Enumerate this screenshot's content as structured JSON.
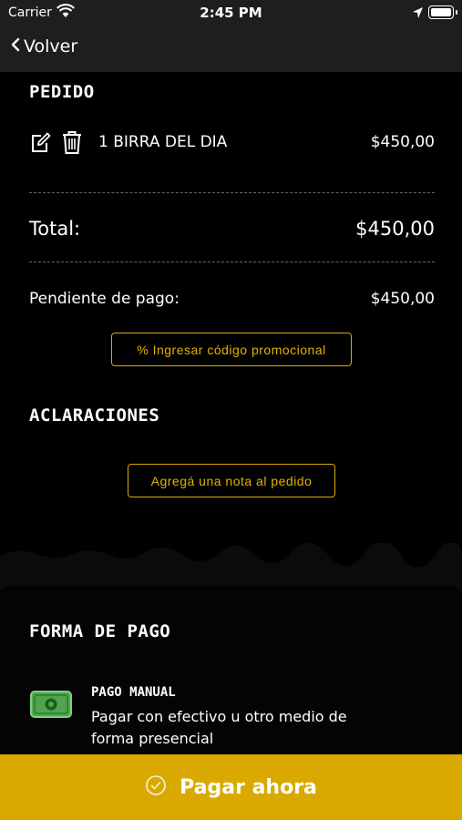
{
  "status_bar": {
    "carrier": "Carrier",
    "time": "2:45 PM"
  },
  "nav": {
    "back_label": "Volver"
  },
  "order": {
    "heading": "PEDIDO",
    "items": [
      {
        "name": "1 BIRRA DEL DIA",
        "price": "$450,00"
      }
    ],
    "total_label": "Total:",
    "total_value": "$450,00",
    "pending_label": "Pendiente de pago:",
    "pending_value": "$450,00",
    "promo_label": "% Ingresar código promocional"
  },
  "notes": {
    "heading": "ACLARACIONES",
    "add_note_label": "Agregá una nota al pedido"
  },
  "payment": {
    "heading": "FORMA DE PAGO",
    "method_title": "PAGO MANUAL",
    "method_desc": "Pagar con efectivo u otro medio de forma presencial"
  },
  "pay_button": {
    "label": "Pagar ahora"
  },
  "colors": {
    "accent": "#d9a900",
    "background": "#000000",
    "bar": "#1e1e1e"
  },
  "icons": [
    "wifi-icon",
    "location-arrow-icon",
    "battery-icon",
    "chevron-left-icon",
    "edit-icon",
    "trash-icon",
    "cash-icon",
    "check-circle-icon"
  ]
}
